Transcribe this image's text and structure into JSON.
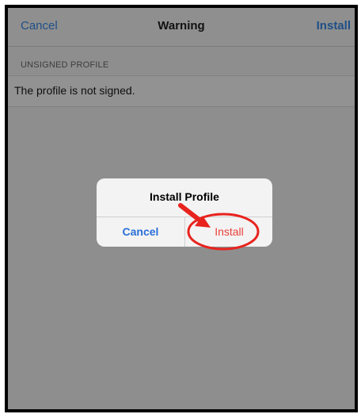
{
  "navbar": {
    "cancel_label": "Cancel",
    "title": "Warning",
    "install_label": "Install"
  },
  "section": {
    "header": "UNSIGNED PROFILE",
    "row_text": "The profile is not signed."
  },
  "alert": {
    "title": "Install Profile",
    "cancel_label": "Cancel",
    "install_label": "Install"
  },
  "annotation": {
    "arrow_icon": "red-arrow-icon",
    "circle_icon": "red-circle-highlight",
    "color": "#e8231e"
  },
  "colors": {
    "link": "#1f4f86",
    "alert_cancel": "#2970d8",
    "alert_install": "#e8413a",
    "overlay": "#8e8e8e"
  }
}
